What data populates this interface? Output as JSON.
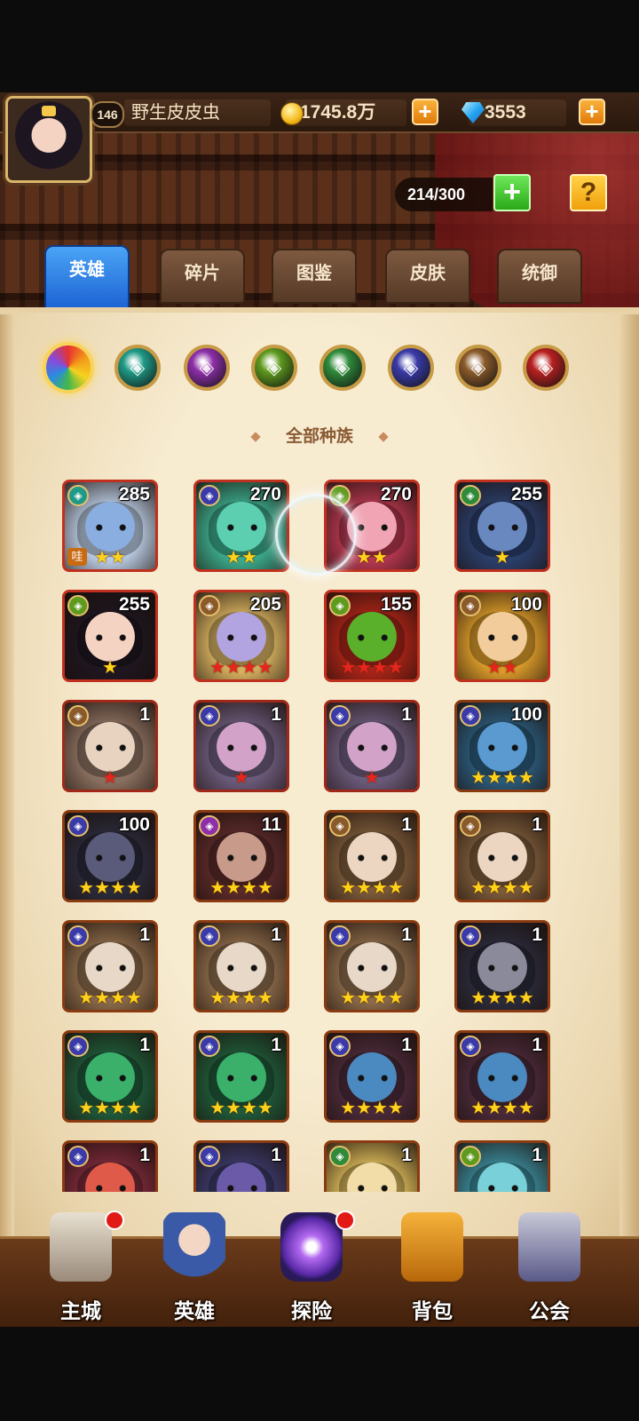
{
  "player": {
    "level": "146",
    "name": "野生皮皮虫"
  },
  "resources": {
    "gold": "1745.8万",
    "diamonds": "3553",
    "plus": "+"
  },
  "capacity": {
    "text": "214/300",
    "plus": "+",
    "help": "?"
  },
  "tabs": [
    {
      "label": "英雄",
      "active": true
    },
    {
      "label": "碎片",
      "active": false
    },
    {
      "label": "图鉴",
      "active": false
    },
    {
      "label": "皮肤",
      "active": false
    },
    {
      "label": "统御",
      "active": false
    }
  ],
  "race_filters": [
    {
      "icon": "all-races-icon",
      "color": "#e8322f",
      "selected": true
    },
    {
      "icon": "race-1-icon",
      "color": "#1f9a86"
    },
    {
      "icon": "race-2-icon",
      "color": "#8d2fa8"
    },
    {
      "icon": "race-3-icon",
      "color": "#5e9a1e"
    },
    {
      "icon": "race-4-icon",
      "color": "#2f8a3a"
    },
    {
      "icon": "race-5-icon",
      "color": "#3a3aa8"
    },
    {
      "icon": "race-6-icon",
      "color": "#8a5a2a"
    },
    {
      "icon": "race-7-icon",
      "color": "#b82020"
    }
  ],
  "section_title": "全部种族",
  "heroes": [
    {
      "level": "285",
      "stars": "★★",
      "star_color": "gold",
      "tag": "哇",
      "bg": "#b7c9e0",
      "face": "#8aaee0",
      "race": "#1f9a86",
      "frame": "#c0301e"
    },
    {
      "level": "270",
      "stars": "★★",
      "star_color": "gold",
      "bg": "#3aa88a",
      "face": "#5ccfb0",
      "race": "#3a3aa8",
      "frame": "#c0301e"
    },
    {
      "level": "270",
      "stars": "★★",
      "star_color": "gold",
      "bg": "#b2364e",
      "face": "#f0a4b4",
      "race": "#5e9a1e",
      "frame": "#c0301e"
    },
    {
      "level": "255",
      "stars": "★",
      "star_color": "gold",
      "bg": "#2a3e6a",
      "face": "#6a88c0",
      "race": "#2f8a3a",
      "frame": "#c0301e"
    },
    {
      "level": "255",
      "stars": "★",
      "star_color": "gold",
      "bg": "#1e1620",
      "face": "#f4d3c2",
      "race": "#5e9a1e",
      "frame": "#c0301e"
    },
    {
      "level": "205",
      "stars": "★★★★",
      "star_color": "red",
      "bg": "#d4b060",
      "face": "#b2a4e0",
      "race": "#8a5a2a",
      "frame": "#c0301e"
    },
    {
      "level": "155",
      "stars": "★★★★",
      "star_color": "red",
      "bg": "#a82418",
      "face": "#5ab02a",
      "race": "#5e9a1e",
      "frame": "#c0301e"
    },
    {
      "level": "100",
      "stars": "★★",
      "star_color": "red",
      "bg": "#d89a2a",
      "face": "#f2cc9a",
      "race": "#8a5a2a",
      "frame": "#c0301e"
    },
    {
      "level": "1",
      "stars": "★",
      "star_color": "red",
      "bg": "#8a7060",
      "face": "#e8d2c0",
      "race": "#8a5a2a",
      "frame": "#a02818"
    },
    {
      "level": "1",
      "stars": "★",
      "star_color": "red",
      "bg": "#6a5a7a",
      "face": "#d2a2c8",
      "race": "#3a3aa8",
      "frame": "#a02818"
    },
    {
      "level": "1",
      "stars": "★",
      "star_color": "red",
      "bg": "#6a5a7a",
      "face": "#d2a2c8",
      "race": "#3a3aa8",
      "frame": "#a02818"
    },
    {
      "level": "100",
      "stars": "★★★★",
      "star_color": "gold",
      "bg": "#2a5a7a",
      "face": "#5a9ad0",
      "race": "#3a3aa8",
      "frame": "#8a3a10"
    },
    {
      "level": "100",
      "stars": "★★★★",
      "star_color": "gold",
      "bg": "#2a2a3a",
      "face": "#5a5a7a",
      "race": "#3a3aa8",
      "frame": "#8a3a10"
    },
    {
      "level": "11",
      "stars": "★★★★",
      "star_color": "gold",
      "bg": "#5a2a2a",
      "face": "#c89a8a",
      "race": "#8d2fa8",
      "frame": "#8a3a10"
    },
    {
      "level": "1",
      "stars": "★★★★",
      "star_color": "gold",
      "bg": "#7a5a3a",
      "face": "#ecd6c2",
      "race": "#8a5a2a",
      "frame": "#8a3a10"
    },
    {
      "level": "1",
      "stars": "★★★★",
      "star_color": "gold",
      "bg": "#7a5a3a",
      "face": "#ecd6c2",
      "race": "#8a5a2a",
      "frame": "#8a3a10"
    },
    {
      "level": "1",
      "stars": "★★★★",
      "star_color": "gold",
      "bg": "#8a6a4a",
      "face": "#e8d8c8",
      "race": "#3a3aa8",
      "frame": "#8a3a10"
    },
    {
      "level": "1",
      "stars": "★★★★",
      "star_color": "gold",
      "bg": "#8a6a4a",
      "face": "#e8d8c8",
      "race": "#3a3aa8",
      "frame": "#8a3a10"
    },
    {
      "level": "1",
      "stars": "★★★★",
      "star_color": "gold",
      "bg": "#8a6a4a",
      "face": "#e8d8c8",
      "race": "#3a3aa8",
      "frame": "#8a3a10"
    },
    {
      "level": "1",
      "stars": "★★★★",
      "star_color": "gold",
      "bg": "#2a2a3a",
      "face": "#8a8a9a",
      "race": "#3a3aa8",
      "frame": "#8a3a10"
    },
    {
      "level": "1",
      "stars": "★★★★",
      "star_color": "gold",
      "bg": "#1e5a3a",
      "face": "#3ab06a",
      "race": "#3a3aa8",
      "frame": "#8a3a10"
    },
    {
      "level": "1",
      "stars": "★★★★",
      "star_color": "gold",
      "bg": "#1e5a3a",
      "face": "#3ab06a",
      "race": "#3a3aa8",
      "frame": "#8a3a10"
    },
    {
      "level": "1",
      "stars": "★★★★",
      "star_color": "gold",
      "bg": "#4a2a3a",
      "face": "#4a8ac0",
      "race": "#3a3aa8",
      "frame": "#8a3a10"
    },
    {
      "level": "1",
      "stars": "★★★★",
      "star_color": "gold",
      "bg": "#4a2a3a",
      "face": "#4a8ac0",
      "race": "#3a3aa8",
      "frame": "#8a3a10"
    },
    {
      "level": "1",
      "stars": "",
      "star_color": "gold",
      "bg": "#7a2a3a",
      "face": "#e05a4a",
      "race": "#3a3aa8",
      "frame": "#8a3a10"
    },
    {
      "level": "1",
      "stars": "",
      "star_color": "gold",
      "bg": "#3a3a6a",
      "face": "#6a5aa8",
      "race": "#3a3aa8",
      "frame": "#8a3a10"
    },
    {
      "level": "1",
      "stars": "",
      "star_color": "gold",
      "bg": "#d8b85a",
      "face": "#f2dca8",
      "race": "#2f8a3a",
      "frame": "#8a3a10"
    },
    {
      "level": "1",
      "stars": "",
      "star_color": "gold",
      "bg": "#3a8a9a",
      "face": "#7ad0d8",
      "race": "#5e9a1e",
      "frame": "#8a3a10"
    }
  ],
  "bottom_nav": [
    {
      "label": "主城",
      "icon": "castle-icon",
      "dot": true
    },
    {
      "label": "英雄",
      "icon": "hero-icon",
      "dot": false
    },
    {
      "label": "探险",
      "icon": "portal-icon",
      "dot": true
    },
    {
      "label": "背包",
      "icon": "backpack-icon",
      "dot": false
    },
    {
      "label": "公会",
      "icon": "guild-icon",
      "dot": false
    }
  ]
}
